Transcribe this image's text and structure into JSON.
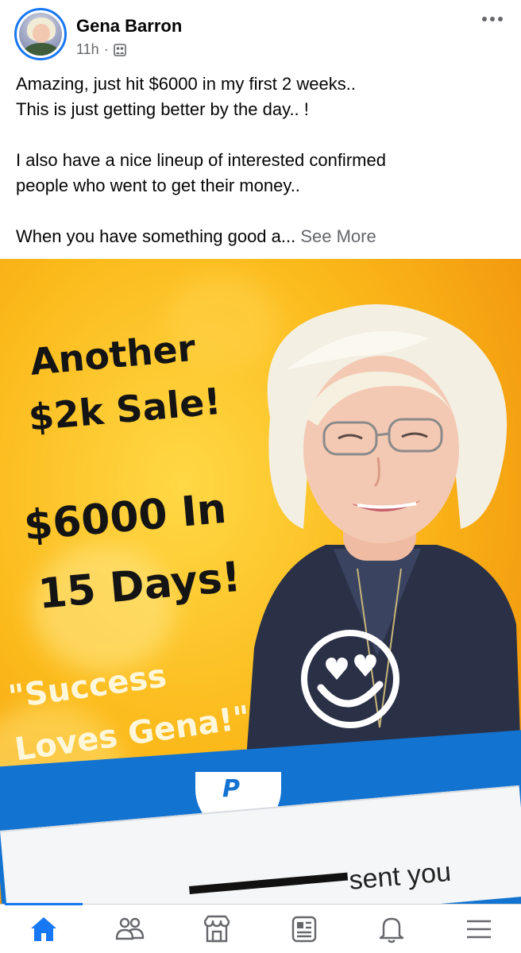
{
  "post": {
    "author": "Gena Barron",
    "time": "11h",
    "separator": "·",
    "privacy_icon": "group-icon",
    "more_icon": "more-options-icon",
    "text_lines": [
      "Amazing, just hit $6000 in my first 2 weeks..",
      "This is just getting better by the day..  !",
      "I also have a nice lineup of interested confirmed",
      "people who went to get their money..",
      "When you have something good a... "
    ],
    "see_more": "See More"
  },
  "image": {
    "headline_1": "Another",
    "headline_2": "$2k Sale!",
    "headline_3": "$6000 In",
    "headline_4": "15 Days!",
    "quote_1": "\"Success",
    "quote_2": "Loves Gena!\"",
    "payment_text": "sent you",
    "emoji": "heart-eyes-emoji-icon"
  },
  "tab_bar": {
    "active_tab": "home",
    "tabs": [
      "home-icon",
      "friends-icon",
      "marketplace-icon",
      "news-feed-icon",
      "notifications-icon",
      "menu-icon"
    ],
    "accent_color": "#1877f2"
  }
}
